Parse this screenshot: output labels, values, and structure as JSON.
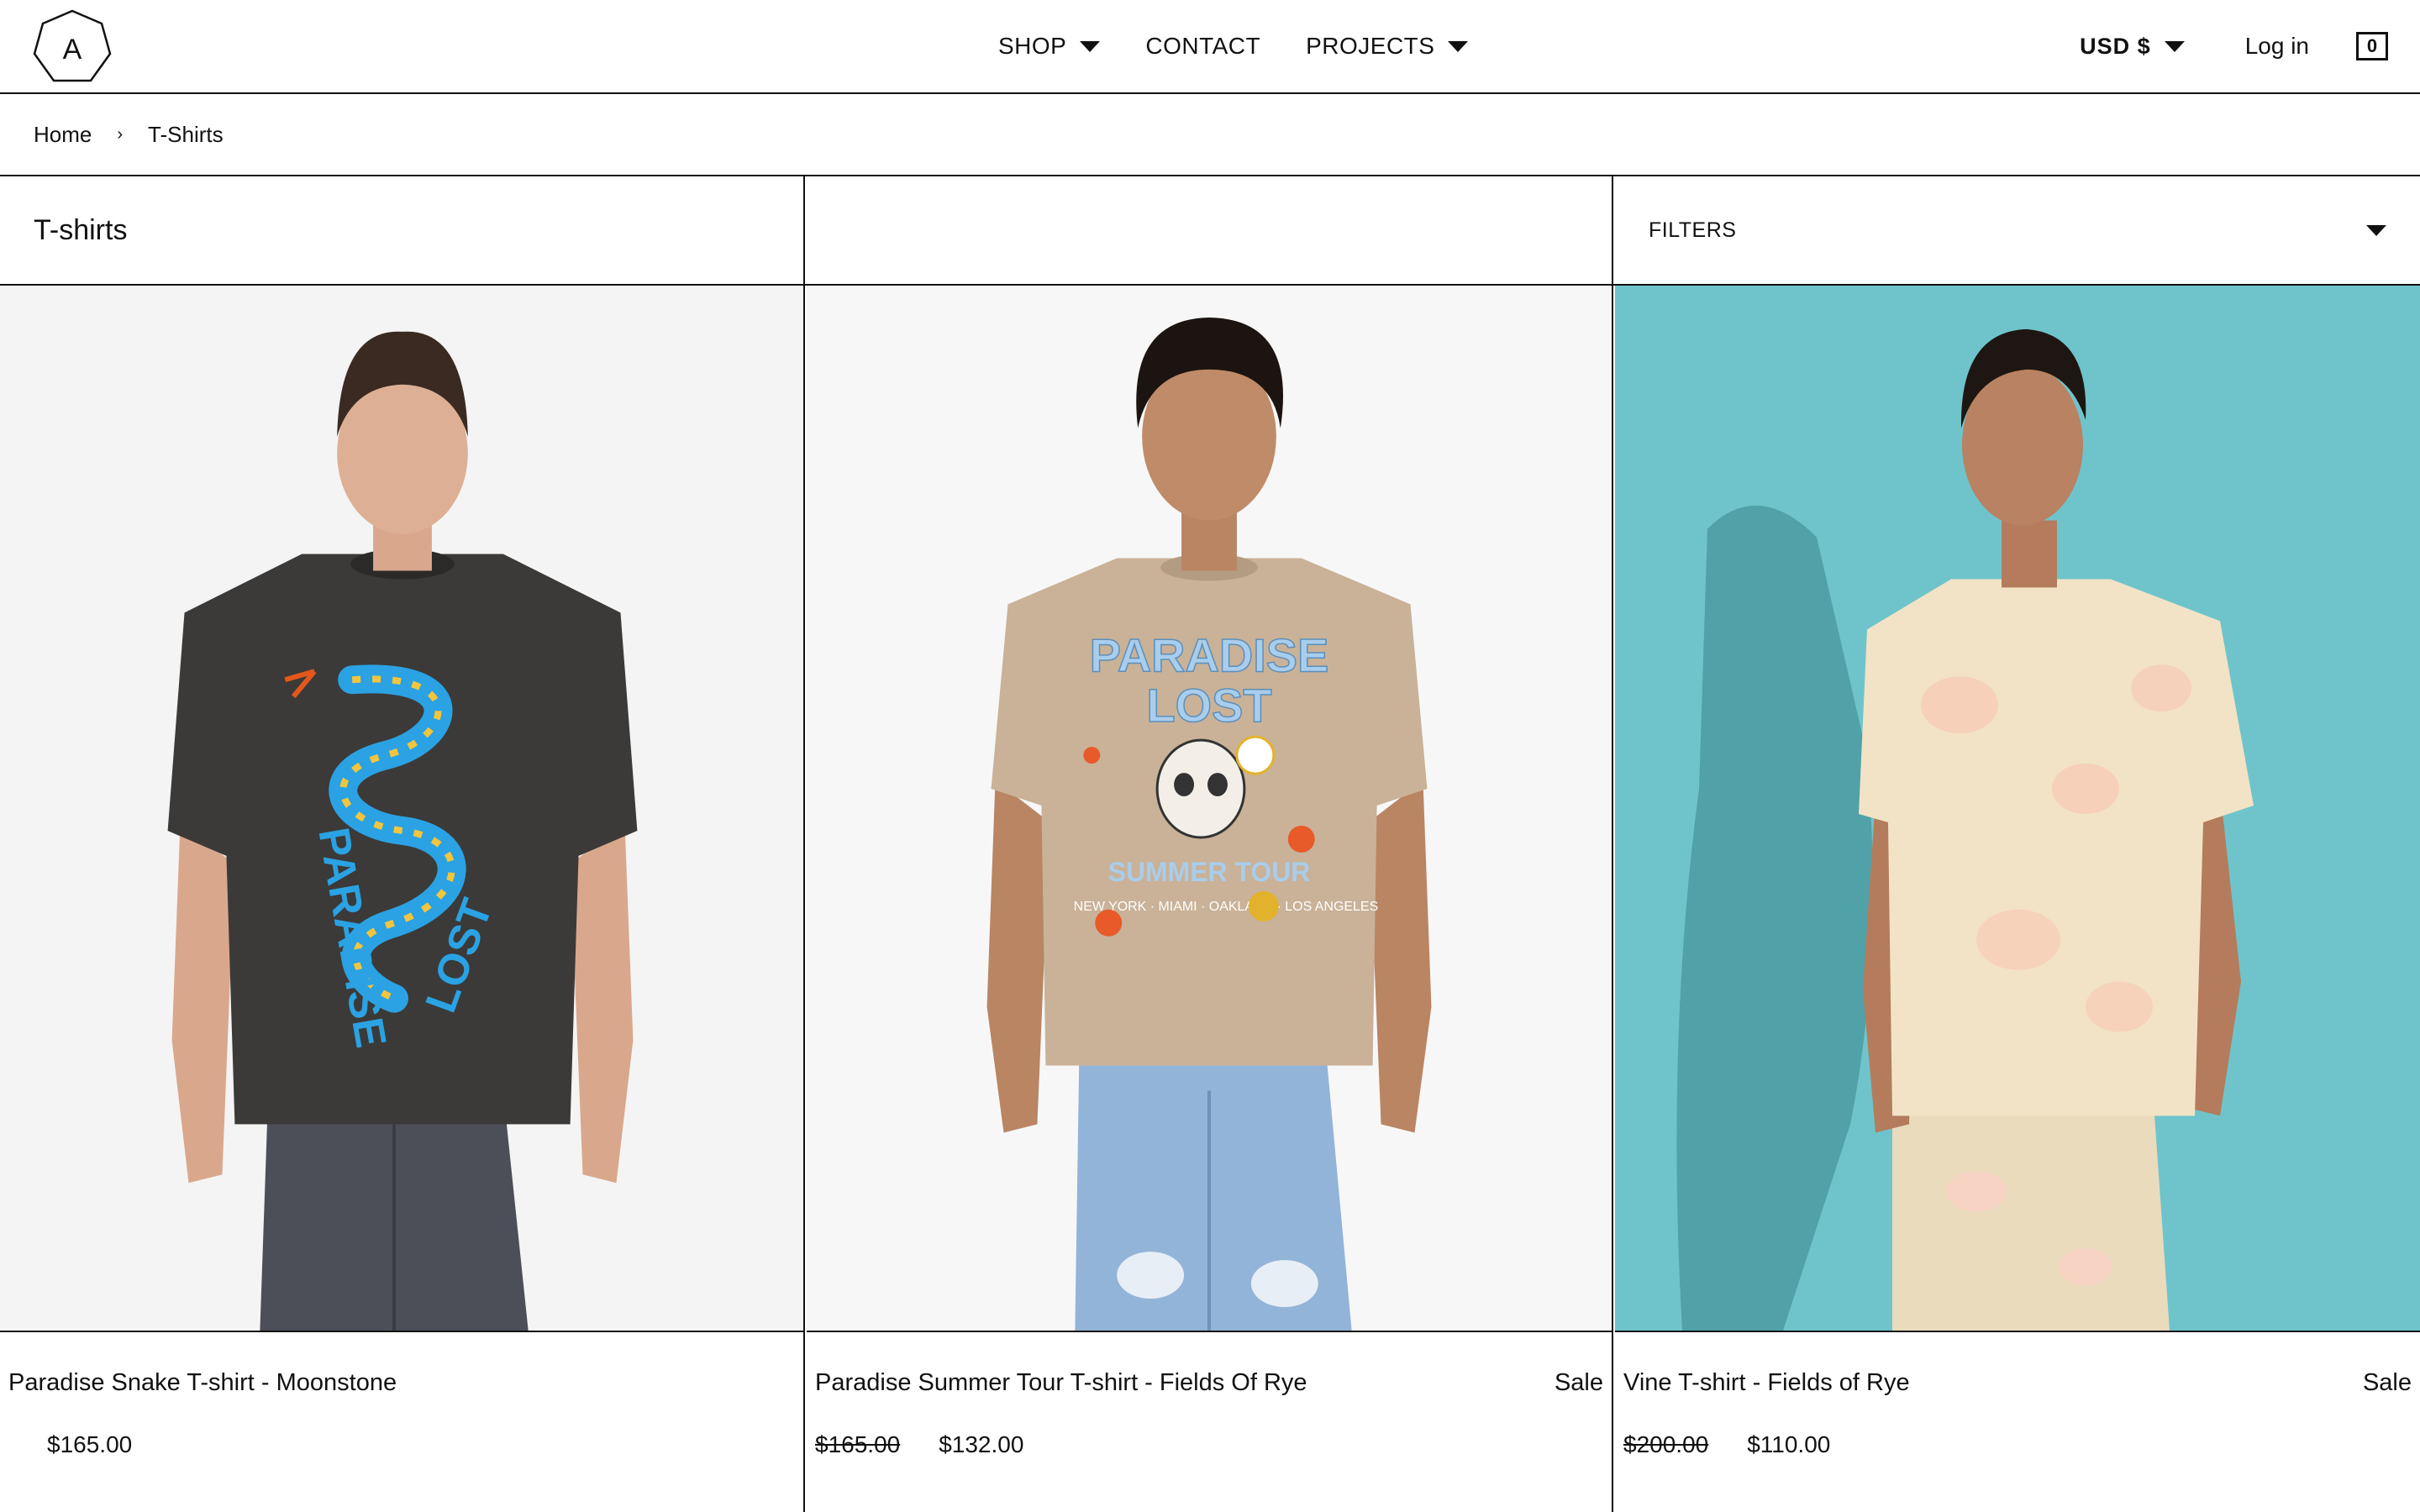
{
  "header": {
    "logo_letter": "A",
    "nav": [
      {
        "label": "SHOP",
        "has_dropdown": true
      },
      {
        "label": "CONTACT",
        "has_dropdown": false
      },
      {
        "label": "PROJECTS",
        "has_dropdown": true
      }
    ],
    "currency": "USD $",
    "login": "Log in",
    "cart_count": "0"
  },
  "breadcrumb": {
    "home": "Home",
    "separator": "›",
    "current": "T-Shirts"
  },
  "collection": {
    "title": "T-shirts",
    "filters_label": "FILTERS"
  },
  "products": [
    {
      "name": "Paradise Snake T-shirt - Moonstone",
      "price": "$165.00",
      "compare_price": "",
      "sale_label": "",
      "image": {
        "bg": "#f5f5f5",
        "shirt": "#3b3a38",
        "pants": "#4a4d55",
        "print": "snake",
        "skin": "#d9a88c",
        "hair": "#3a2a22"
      }
    },
    {
      "name": "Paradise Summer Tour T-shirt - Fields Of Rye",
      "price": "$132.00",
      "compare_price": "$165.00",
      "sale_label": "Sale",
      "image": {
        "bg": "#f7f7f7",
        "shirt": "#c9b298",
        "pants": "#8fb0d6",
        "print": "skull",
        "skin": "#b98563",
        "hair": "#1c1410"
      }
    },
    {
      "name": "Vine T-shirt - Fields of Rye",
      "price": "$110.00",
      "compare_price": "$200.00",
      "sale_label": "Sale",
      "image": {
        "bg": "#6fc4cb",
        "shirt": "#f2e3c6",
        "pants": "#eadbbd",
        "print": "floral",
        "skin": "#b47c5c",
        "hair": "#1e1612"
      }
    }
  ]
}
